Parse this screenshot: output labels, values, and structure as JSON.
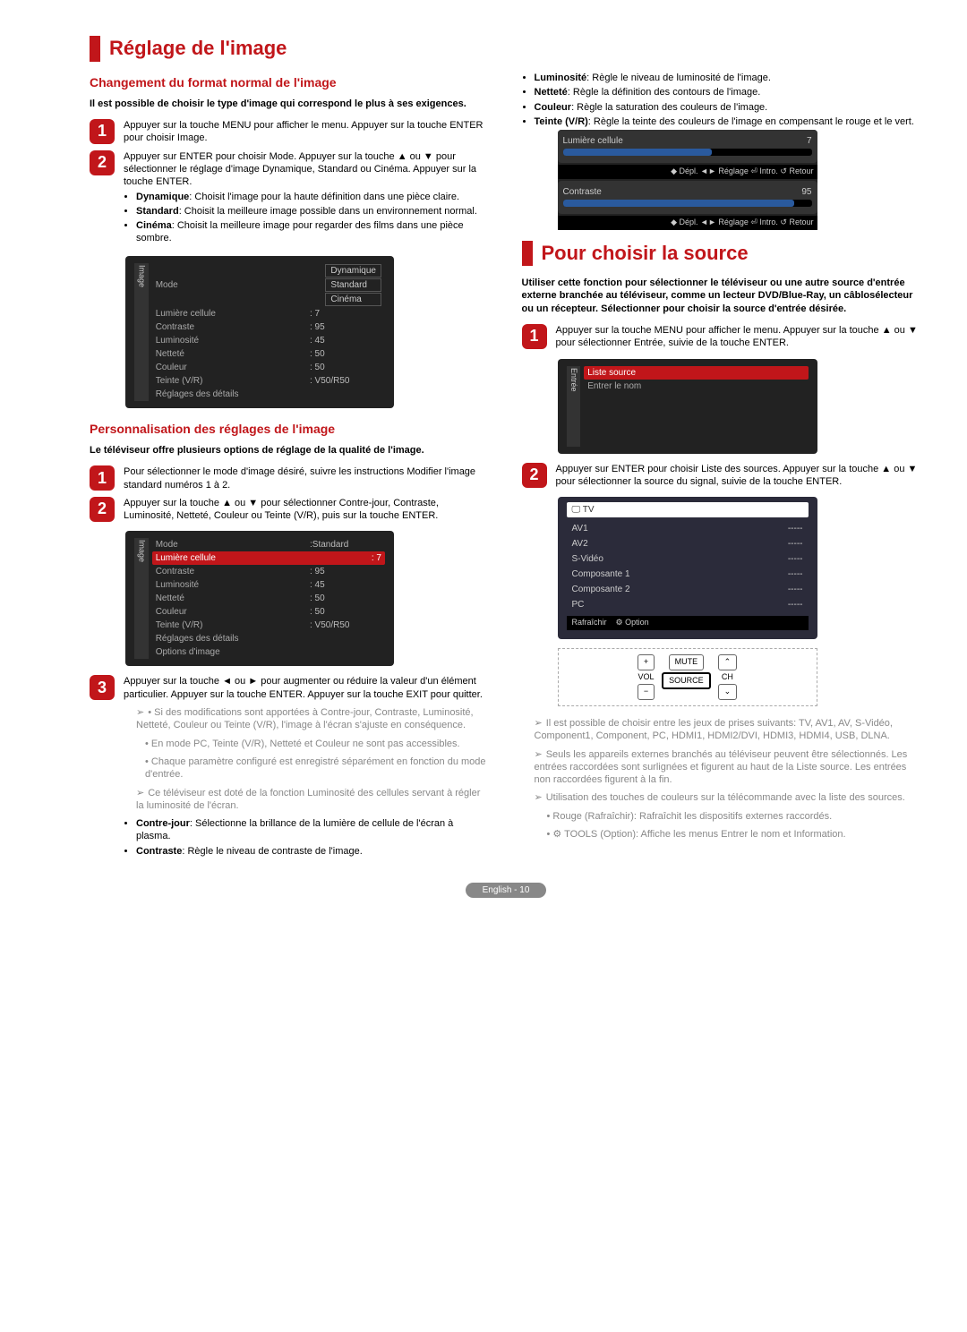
{
  "left": {
    "h1": "Réglage de l'image",
    "sec1": {
      "h2": "Changement du format normal de l'image",
      "intro": "Il est possible de choisir le type d'image qui correspond le plus à ses exigences.",
      "step1": "Appuyer sur la touche MENU pour afficher le menu. Appuyer sur la touche ENTER pour choisir Image.",
      "step2": "Appuyer sur ENTER pour choisir Mode. Appuyer sur la touche ▲ ou ▼ pour sélectionner le réglage d'image Dynamique, Standard ou Cinéma. Appuyer sur la touche ENTER.",
      "bullets": [
        {
          "b": "Dynamique",
          "t": ": Choisit l'image pour la haute définition dans une pièce claire."
        },
        {
          "b": "Standard",
          "t": ": Choisit la meilleure image possible dans un environnement normal."
        },
        {
          "b": "Cinéma",
          "t": ": Choisit la meilleure image pour regarder des films dans une pièce sombre."
        }
      ],
      "osd": {
        "side": "Image",
        "rows": [
          {
            "l": "Mode",
            "opts": [
              "Dynamique",
              "Standard",
              "Cinéma"
            ]
          },
          {
            "l": "Lumière cellule",
            "v": ": 7"
          },
          {
            "l": "Contraste",
            "v": ": 95"
          },
          {
            "l": "Luminosité",
            "v": ": 45"
          },
          {
            "l": "Netteté",
            "v": ": 50"
          },
          {
            "l": "Couleur",
            "v": ": 50"
          },
          {
            "l": "Teinte (V/R)",
            "v": ": V50/R50"
          },
          {
            "l": "Réglages des détails",
            "v": ""
          }
        ]
      }
    },
    "sec2": {
      "h2": "Personnalisation des réglages de l'image",
      "intro": "Le téléviseur offre plusieurs options de réglage de la qualité de l'image.",
      "step1": "Pour sélectionner le mode d'image désiré, suivre les instructions Modifier l'image standard numéros 1 à 2.",
      "step2": "Appuyer sur la touche ▲ ou ▼ pour sélectionner Contre-jour, Contraste, Luminosité, Netteté, Couleur ou Teinte (V/R), puis sur la touche ENTER.",
      "osd": {
        "side": "Image",
        "rows": [
          {
            "l": "Mode",
            "v": ":Standard"
          },
          {
            "l": "Lumière cellule",
            "v": ": 7",
            "hl": true
          },
          {
            "l": "Contraste",
            "v": ": 95"
          },
          {
            "l": "Luminosité",
            "v": ": 45"
          },
          {
            "l": "Netteté",
            "v": ": 50"
          },
          {
            "l": "Couleur",
            "v": ": 50"
          },
          {
            "l": "Teinte (V/R)",
            "v": ": V50/R50"
          },
          {
            "l": "Réglages des détails",
            "v": ""
          },
          {
            "l": "Options d'image",
            "v": ""
          }
        ]
      },
      "step3": "Appuyer sur la touche ◄ ou ► pour augmenter ou réduire la valeur d'un élément particulier. Appuyer sur la touche ENTER. Appuyer sur la touche EXIT pour quitter.",
      "notesGray": [
        "Si des modifications sont apportées à Contre-jour, Contraste, Luminosité, Netteté, Couleur ou Teinte (V/R), l'image à l'écran s'ajuste en conséquence.",
        "En mode PC, Teinte (V/R), Netteté et Couleur ne sont pas accessibles.",
        "Chaque paramètre configuré est enregistré séparément en fonction du mode d'entrée.",
        "Ce téléviseur est doté de la fonction Luminosité des cellules servant à régler la luminosité de l'écran."
      ],
      "bulletsBlack": [
        {
          "b": "Contre-jour",
          "t": ": Sélectionne la brillance de la lumière de cellule de l'écran à plasma."
        },
        {
          "b": "Contraste",
          "t": ": Règle le niveau de contraste de l'image."
        }
      ]
    }
  },
  "right": {
    "topBullets": [
      {
        "b": "Luminosité",
        "t": ": Règle le niveau de luminosité de l'image."
      },
      {
        "b": "Netteté",
        "t": ": Règle la définition des contours de l'image."
      },
      {
        "b": "Couleur",
        "t": ": Règle la saturation des couleurs de l'image."
      },
      {
        "b": "Teinte (V/R)",
        "t": ": Règle la teinte des couleurs de l'image en compensant le rouge et le vert."
      }
    ],
    "slider1": {
      "label": "Lumière cellule",
      "val": "7",
      "ctl": "◆ Dépl.   ◄► Réglage   ⏎ Intro.   ↺ Retour"
    },
    "slider2": {
      "label": "Contraste",
      "val": "95",
      "ctl": "◆ Dépl.   ◄► Réglage   ⏎ Intro.   ↺ Retour"
    },
    "h1": "Pour choisir la source",
    "intro": "Utiliser cette fonction pour sélectionner le téléviseur ou une autre source d'entrée externe branchée au téléviseur, comme un lecteur DVD/Blue-Ray, un câblosélecteur ou un récepteur. Sélectionner pour choisir la source d'entrée désirée.",
    "step1": "Appuyer sur la touche MENU pour afficher le menu. Appuyer sur la touche ▲ ou ▼ pour sélectionner Entrée, suivie de la touche ENTER.",
    "osd1": {
      "side": "Entrée",
      "rows": [
        {
          "l": "Liste source",
          "hl": true
        },
        {
          "l": "Entrer le nom"
        }
      ]
    },
    "step2": "Appuyer sur ENTER pour choisir Liste des sources. Appuyer sur la touche ▲ ou ▼ pour sélectionner la source du signal, suivie de la touche ENTER.",
    "srcBox": {
      "head": "🖵  TV",
      "rows": [
        {
          "l": "AV1",
          "v": "-----"
        },
        {
          "l": "AV2",
          "v": "-----"
        },
        {
          "l": "S-Vidéo",
          "v": "-----"
        },
        {
          "l": "Composante 1",
          "v": "-----"
        },
        {
          "l": "Composante 2",
          "v": "-----"
        },
        {
          "l": "PC",
          "v": "-----"
        }
      ],
      "bar": {
        "a": "Rafraîchir",
        "b": "⚙ Option"
      }
    },
    "remote": {
      "vol": "VOL",
      "plus": "+",
      "minus": "−",
      "mute": "MUTE",
      "source": "SOURCE",
      "ch": "CH",
      "up": "⌃",
      "down": "⌄"
    },
    "notes": [
      {
        "gray": true,
        "t": "Il est possible de choisir entre les jeux de prises suivants: TV, AV1, AV, S-Vidéo, Component1, Component, PC, HDMI1, HDMI2/DVI, HDMI3, HDMI4, USB, DLNA."
      },
      {
        "gray": true,
        "t": "Seuls les appareils externes branchés au téléviseur peuvent être sélectionnés. Les entrées raccordées sont surlignées et figurent au haut de la Liste source. Les entrées non raccordées figurent à la fin."
      },
      {
        "gray": true,
        "t": "Utilisation des touches de couleurs sur la télécommande avec la liste des sources."
      },
      {
        "sub": true,
        "gray": true,
        "t": "• Rouge (Rafraîchir): Rafraîchit les dispositifs externes raccordés."
      },
      {
        "sub": true,
        "gray": true,
        "t": "• ⚙ TOOLS (Option): Affiche les menus Entrer le nom et Information."
      }
    ]
  },
  "footer": "English - 10"
}
